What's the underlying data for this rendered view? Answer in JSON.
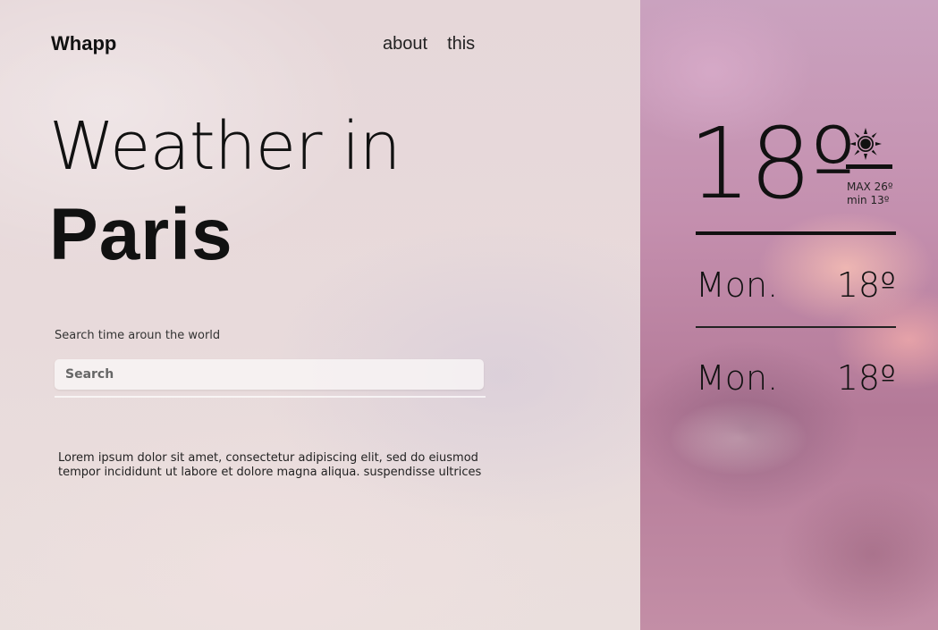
{
  "brand": "Whapp",
  "nav": {
    "items": [
      "about",
      "this"
    ]
  },
  "hero": {
    "headline": "Weather in",
    "city": "Paris"
  },
  "search": {
    "label": "Search time aroun the world",
    "placeholder": "Search"
  },
  "description": "Lorem ipsum dolor sit amet, consectetur adipiscing elit, sed do eiusmod tempor incididunt ut labore et dolore magna aliqua. suspendisse ultrices",
  "current": {
    "temp": "18º",
    "icon": "sun-icon",
    "max": "MAX 26º",
    "min": "min 13º"
  },
  "forecast": [
    {
      "day": "Mon.",
      "temp": "18º"
    },
    {
      "day": "Mon.",
      "temp": "18º"
    }
  ]
}
